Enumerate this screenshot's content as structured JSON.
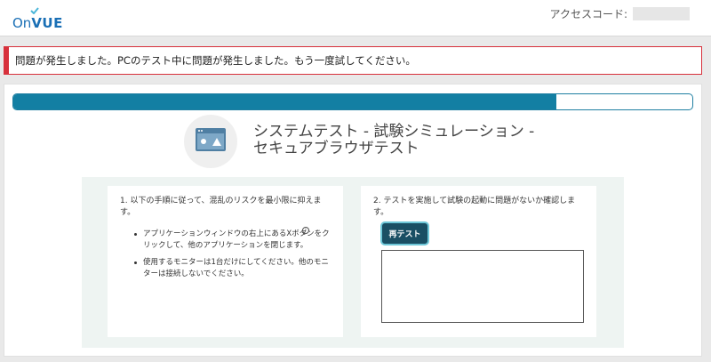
{
  "header": {
    "logo_on": "On",
    "logo_vue": "VUE",
    "access_code_label": "アクセスコード:"
  },
  "alert": {
    "message": "問題が発生しました。PCのテスト中に問題が発生しました。もう一度試してください。",
    "color": "#d7303b"
  },
  "progress": {
    "fraction": 0.8
  },
  "title": {
    "line1": "システムテスト - 試験シミュレーション -",
    "line2": "セキュアブラウザテスト",
    "icon": "browser-window-icon"
  },
  "left_card": {
    "step": "1. 以下の手順に従って、混乱のリスクを最小限に抑えます。",
    "bullets": [
      "アプリケーションウィンドウの右上にあるXボタンをクリックして、他のアプリケーションを閉じます。",
      "使用するモニターは1台だけにしてください。他のモニターは接続しないでください。"
    ]
  },
  "right_card": {
    "step": "2. テストを実施して試験の起動に問題がないか確認します。",
    "retest_label": "再テスト"
  },
  "colors": {
    "accent": "#137fa3",
    "button": "#1a4f64",
    "logo": "#1a6fb5"
  }
}
